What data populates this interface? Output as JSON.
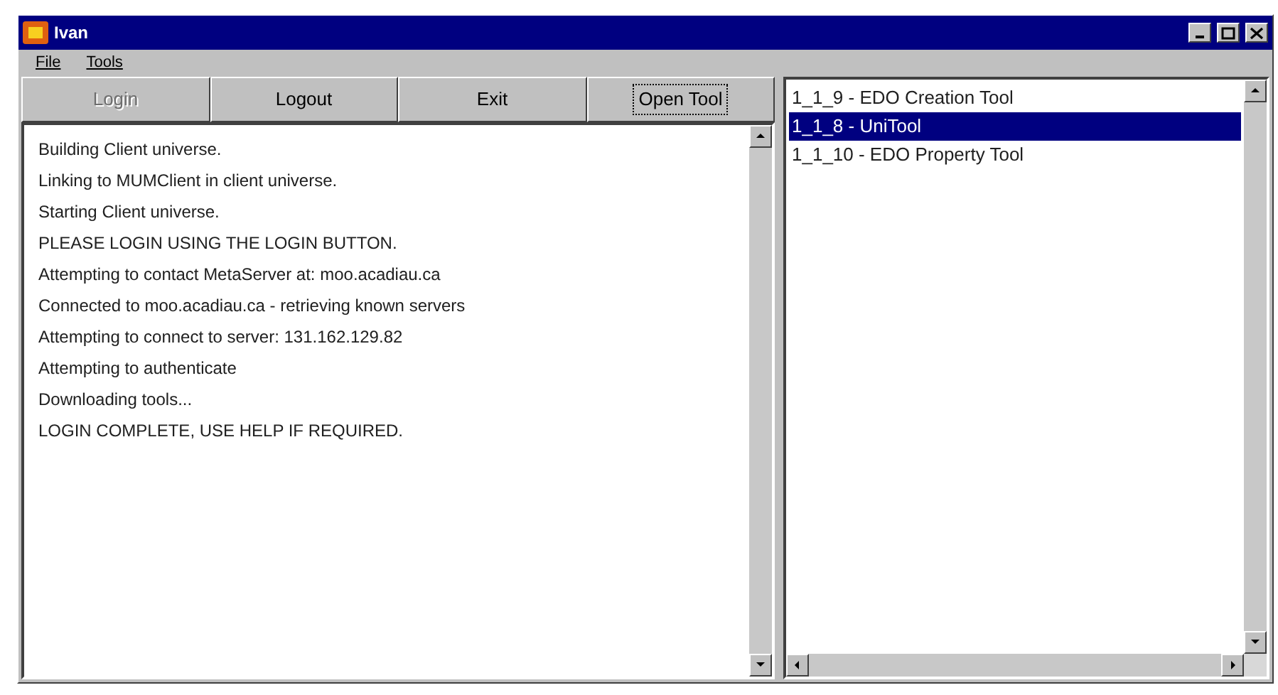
{
  "window": {
    "title": "Ivan"
  },
  "menu": [
    "File",
    "Tools"
  ],
  "buttons": [
    {
      "label": "Login",
      "disabled": true,
      "focused": false
    },
    {
      "label": "Logout",
      "disabled": false,
      "focused": false
    },
    {
      "label": "Exit",
      "disabled": false,
      "focused": false
    },
    {
      "label": "Open Tool",
      "disabled": false,
      "focused": true
    }
  ],
  "log": [
    "Building Client universe.",
    "Linking to MUMClient in client universe.",
    "Starting Client universe.",
    "PLEASE LOGIN USING THE LOGIN BUTTON.",
    "Attempting to contact MetaServer at: moo.acadiau.ca",
    "Connected to moo.acadiau.ca - retrieving known servers",
    "Attempting to connect to server: 131.162.129.82",
    "Attempting to authenticate",
    "Downloading tools...",
    "LOGIN COMPLETE, USE HELP IF REQUIRED."
  ],
  "tools": [
    {
      "label": "1_1_9 - EDO Creation Tool",
      "selected": false
    },
    {
      "label": "1_1_8 - UniTool",
      "selected": true
    },
    {
      "label": "1_1_10 - EDO Property Tool",
      "selected": false
    }
  ]
}
